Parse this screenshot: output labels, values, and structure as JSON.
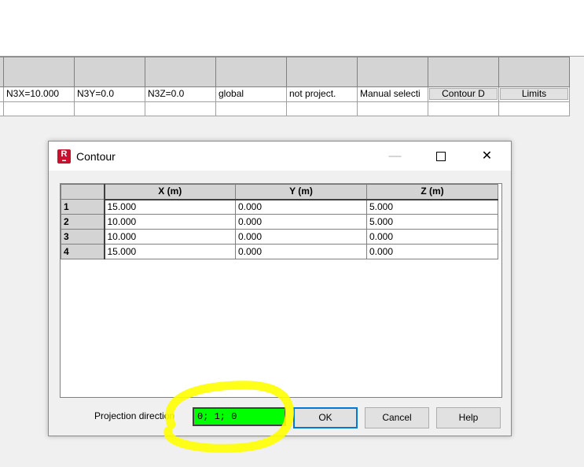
{
  "background_table": {
    "row1": [
      "",
      "N3X=10.000",
      "N3Y=0.0",
      "N3Z=0.0",
      "global",
      "not project.",
      "Manual selecti"
    ],
    "buttons": [
      "Contour D",
      "Limits"
    ]
  },
  "dialog": {
    "title": "Contour",
    "app_icon_letter": "R",
    "columns": [
      "X (m)",
      "Y (m)",
      "Z (m)"
    ],
    "rows": [
      {
        "id": "1",
        "x": "15.000",
        "y": "0.000",
        "z": "5.000"
      },
      {
        "id": "2",
        "x": "10.000",
        "y": "0.000",
        "z": "5.000"
      },
      {
        "id": "3",
        "x": "10.000",
        "y": "0.000",
        "z": "0.000"
      },
      {
        "id": "4",
        "x": "15.000",
        "y": "0.000",
        "z": "0.000"
      }
    ],
    "projection_label": "Projection direction",
    "projection_value": "0; 1; 0",
    "ok_label": "OK",
    "cancel_label": "Cancel",
    "help_label": "Help"
  },
  "colors": {
    "input_highlight": "#00ff00",
    "annotation": "#ffff00",
    "app_icon": "#c9102f"
  }
}
